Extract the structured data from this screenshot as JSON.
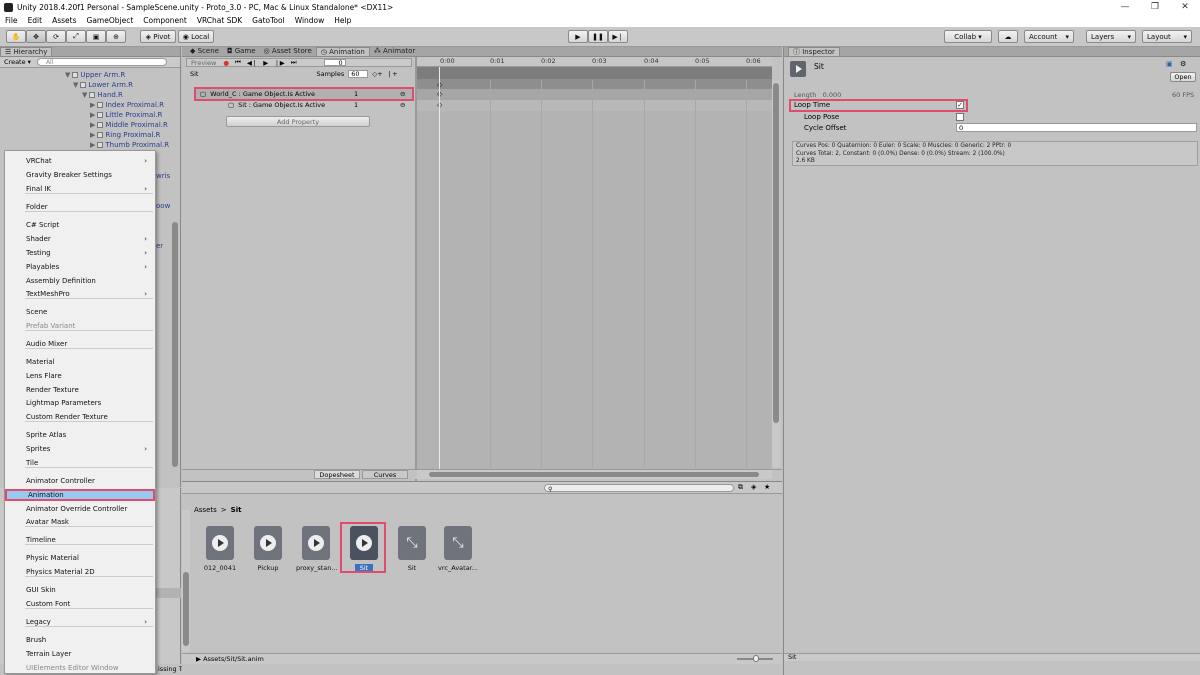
{
  "window": {
    "title": "Unity 2018.4.20f1 Personal - SampleScene.unity - Proto_3.0 - PC, Mac & Linux Standalone* <DX11>",
    "controls": [
      "—",
      "❐",
      "✕"
    ]
  },
  "menubar": [
    "File",
    "Edit",
    "Assets",
    "GameObject",
    "Component",
    "VRChat SDK",
    "GatoTool",
    "Window",
    "Help"
  ],
  "toolbar": {
    "pivot": "Pivot",
    "local": "Local",
    "collab": "Collab ▾",
    "account": "Account",
    "layers": "Layers",
    "layout": "Layout"
  },
  "hierarchy": {
    "tab": "Hierarchy",
    "create": "Create",
    "search_placeholder": "All",
    "rows": [
      {
        "label": "Upper Arm.R",
        "indent": 3
      },
      {
        "label": "Lower Arm.R",
        "indent": 4
      },
      {
        "label": "Hand.R",
        "indent": 5
      },
      {
        "label": "Index Proximal.R",
        "indent": 6
      },
      {
        "label": "Little Proximal.R",
        "indent": 6
      },
      {
        "label": "Middle Proximal.R",
        "indent": 6
      },
      {
        "label": "Ring Proximal.R",
        "indent": 6
      },
      {
        "label": "Thumb Proximal.R",
        "indent": 6
      }
    ],
    "partial": [
      "wris",
      "oow",
      "er"
    ]
  },
  "context_menu": {
    "items": [
      {
        "label": "VRChat",
        "sub": true
      },
      {
        "label": "Gravity Breaker Settings"
      },
      {
        "label": "Final IK",
        "sub": true
      },
      {
        "sep": true
      },
      {
        "label": "Folder"
      },
      {
        "sep": true
      },
      {
        "label": "C# Script"
      },
      {
        "label": "Shader",
        "sub": true
      },
      {
        "label": "Testing",
        "sub": true
      },
      {
        "label": "Playables",
        "sub": true
      },
      {
        "label": "Assembly Definition"
      },
      {
        "label": "TextMeshPro",
        "sub": true
      },
      {
        "sep": true
      },
      {
        "label": "Scene"
      },
      {
        "label": "Prefab Variant",
        "disabled": true
      },
      {
        "sep": true
      },
      {
        "label": "Audio Mixer"
      },
      {
        "sep": true
      },
      {
        "label": "Material"
      },
      {
        "label": "Lens Flare"
      },
      {
        "label": "Render Texture"
      },
      {
        "label": "Lightmap Parameters"
      },
      {
        "label": "Custom Render Texture"
      },
      {
        "sep": true
      },
      {
        "label": "Sprite Atlas"
      },
      {
        "label": "Sprites",
        "sub": true
      },
      {
        "label": "Tile"
      },
      {
        "sep": true
      },
      {
        "label": "Animator Controller"
      },
      {
        "label": "Animation",
        "highlight": true
      },
      {
        "label": "Animator Override Controller"
      },
      {
        "label": "Avatar Mask"
      },
      {
        "sep": true
      },
      {
        "label": "Timeline"
      },
      {
        "sep": true
      },
      {
        "label": "Physic Material"
      },
      {
        "label": "Physics Material 2D"
      },
      {
        "sep": true
      },
      {
        "label": "GUI Skin"
      },
      {
        "label": "Custom Font"
      },
      {
        "sep": true
      },
      {
        "label": "Legacy",
        "sub": true
      },
      {
        "sep": true
      },
      {
        "label": "Brush"
      },
      {
        "label": "Terrain Layer"
      },
      {
        "label": "UIElements Editor Window",
        "disabled": true
      }
    ]
  },
  "center_tabs": [
    "Scene",
    "Game",
    "Asset Store",
    "Animation",
    "Animator"
  ],
  "animation": {
    "preview": "Preview",
    "frame": "0",
    "clip": "Sit",
    "samples_label": "Samples",
    "samples": "60",
    "properties": [
      {
        "label": "World_C : Game Object.Is Active",
        "value": "1"
      },
      {
        "label": "Sit : Game Object.Is Active",
        "value": "1"
      }
    ],
    "add_property": "Add Property",
    "ruler": [
      "0:00",
      "0:01",
      "0:02",
      "0:03",
      "0:04",
      "0:05",
      "0:06"
    ],
    "dopesheet": "Dopesheet",
    "curves": "Curves"
  },
  "project": {
    "breadcrumb": [
      "Assets",
      "Sit"
    ],
    "assets": [
      {
        "name": "012_0041",
        "kind": "anim"
      },
      {
        "name": "Pickup",
        "kind": "anim"
      },
      {
        "name": "proxy_stan...",
        "kind": "anim"
      },
      {
        "name": "Sit",
        "kind": "anim",
        "selected": true
      },
      {
        "name": "Sit",
        "kind": "controller"
      },
      {
        "name": "vrc_Avatar...",
        "kind": "controller"
      }
    ],
    "path": "Assets/Sit/Sit.anim",
    "console": "issing Transforms."
  },
  "inspector": {
    "tab": "Inspector",
    "name": "Sit",
    "open": "Open",
    "length_label": "Length",
    "length": "0.000",
    "fps": "60 FPS",
    "loop_time": "Loop Time",
    "loop_time_checked": true,
    "loop_pose": "Loop Pose",
    "cycle_offset": "Cycle Offset",
    "cycle_offset_value": "0",
    "info": [
      "Curves Pos: 0 Quaternion: 0 Euler: 0 Scale: 0 Muscles: 0 Generic: 2 PPtr: 0",
      "Curves Total: 2, Constant: 0 (0.0%) Dense: 0 (0.0%) Stream: 2 (100.0%)",
      "2.6 KB"
    ],
    "footer": "Sit"
  },
  "colors": {
    "highlight_red": "#e24c6c",
    "menu_selected": "#99c9ef",
    "link_blue": "#2a3d8f"
  }
}
